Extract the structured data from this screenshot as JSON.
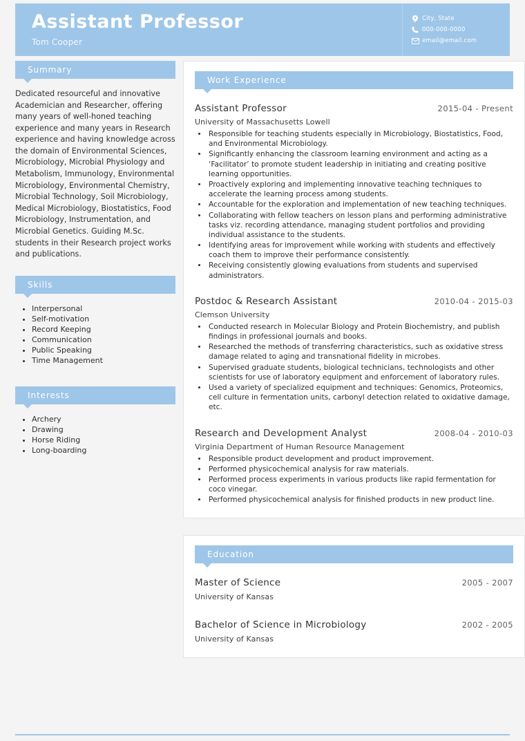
{
  "header": {
    "title": "Assistant Professor",
    "name": "Tom Cooper",
    "contacts": [
      {
        "icon": "location-pin-icon",
        "text": "City, State"
      },
      {
        "icon": "phone-icon",
        "text": "000-000-0000"
      },
      {
        "icon": "envelope-icon",
        "text": "email@email.com"
      }
    ]
  },
  "sidebar": {
    "summary": {
      "heading": "Summary",
      "text": "Dedicated resourceful and innovative Academician and Researcher, offering many years of well-honed teaching experience and many years in Research experience and having knowledge across the domain of Environmental Sciences, Microbiology, Microbial Physiology and Metabolism, Immunology, Environmental Microbiology, Environmental Chemistry, Microbial Technology, Soil Microbiology, Medical Microbiology, Biostatistics, Food Microbiology, Instrumentation, and Microbial Genetics. Guiding M.Sc. students in their Research project works and publications."
    },
    "skills": {
      "heading": "Skills",
      "items": [
        "Interpersonal",
        "Self-motivation",
        "Record Keeping",
        "Communication",
        "Public Speaking",
        "Time Management"
      ]
    },
    "interests": {
      "heading": "Interests",
      "items": [
        "Archery",
        "Drawing",
        "Horse Riding",
        "Long-boarding"
      ]
    }
  },
  "work": {
    "heading": "Work Experience",
    "entries": [
      {
        "title": "Assistant Professor",
        "date": "2015-04 - Present",
        "org": "University of Massachusetts Lowell",
        "bullets": [
          "Responsible for teaching students especially in Microbiology, Biostatistics, Food, and Environmental Microbiology.",
          "Significantly enhancing the classroom learning environment and acting as a ‘Facilitator’ to promote student leadership in initiating and creating positive learning opportunities.",
          "Proactively exploring and implementing innovative teaching techniques to accelerate the learning process among students.",
          "Accountable for the exploration and implementation of new teaching techniques.",
          "Collaborating with fellow teachers on lesson plans and performing administrative tasks viz. recording attendance, managing student portfolios and providing individual assistance to the students.",
          "Identifying areas for improvement while working with students and effectively coach them to improve their performance consistently.",
          "Receiving consistently glowing evaluations from students and supervised administrators."
        ]
      },
      {
        "title": "Postdoc & Research Assistant",
        "date": "2010-04 - 2015-03",
        "org": "Clemson University",
        "bullets": [
          "Conducted research in Molecular Biology and Protein Biochemistry, and publish findings in professional journals and books.",
          "Researched the methods of transferring characteristics, such as oxidative stress damage related to aging and transnational fidelity in microbes.",
          "Supervised graduate students, biological technicians, technologists and other scientists for use of laboratory equipment and enforcement of laboratory rules.",
          "Used a variety of specialized equipment and techniques: Genomics, Proteomics, cell culture in fermentation units, carbonyl detection related to oxidative damage, etc."
        ]
      },
      {
        "title": "Research and Development Analyst",
        "date": "2008-04 - 2010-03",
        "org": "Virginia Department of Human Resource Management",
        "bullets": [
          "Responsible product development and product improvement.",
          "Performed physicochemical analysis for raw materials.",
          "Performed process experiments in various products like rapid fermentation for coco vinegar.",
          "Performed physicochemical analysis for finished products in new product line."
        ]
      }
    ]
  },
  "education": {
    "heading": "Education",
    "entries": [
      {
        "title": "Master of Science",
        "date": "2005 - 2007",
        "org": "University of Kansas"
      },
      {
        "title": "Bachelor of Science in Microbiology",
        "date": "2002 - 2005",
        "org": "University of Kansas"
      }
    ]
  },
  "theme": {
    "accent": "#9ec6e8",
    "page_background": "#f4f4f4",
    "card_background": "#ffffff"
  }
}
